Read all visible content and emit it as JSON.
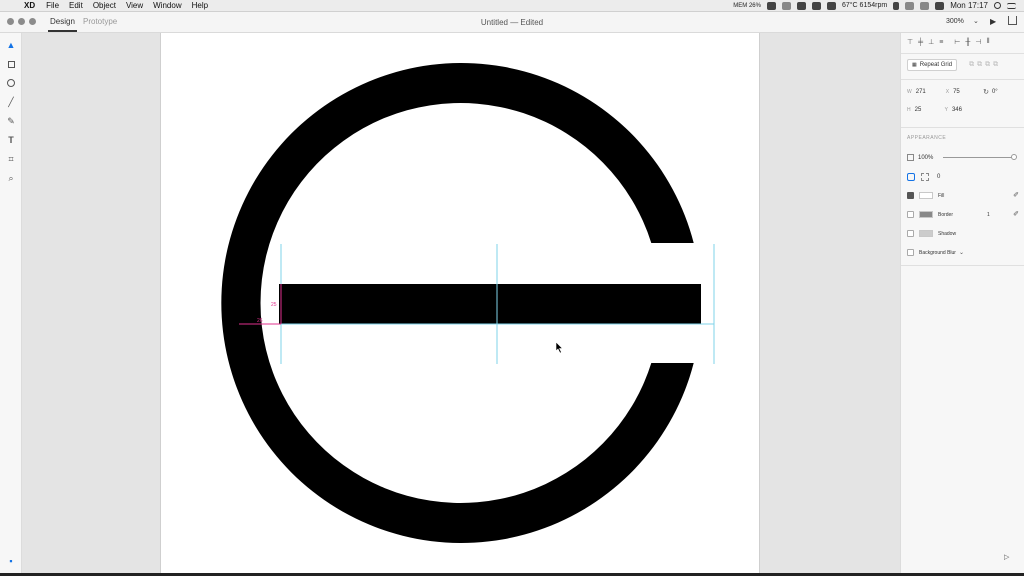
{
  "menubar": {
    "apple_icon": "apple-icon",
    "app": "XD",
    "items": [
      "File",
      "Edit",
      "Object",
      "View",
      "Window",
      "Help"
    ],
    "status": {
      "mem": "MEM 26%",
      "temp": "67°C 6154rpm",
      "clock": "Mon 17:17"
    }
  },
  "titlebar": {
    "tabs": [
      "Design",
      "Prototype"
    ],
    "active_tab": "Design",
    "doc_title": "Untitled — Edited",
    "zoom": "300%"
  },
  "toolbar": {
    "tools": [
      "select-tool-icon",
      "rectangle-tool-icon",
      "ellipse-tool-icon",
      "line-tool-icon",
      "pen-tool-icon",
      "text-tool-icon",
      "artboard-tool-icon",
      "zoom-tool-icon"
    ]
  },
  "canvas": {
    "measure_labels": [
      "25",
      "26"
    ]
  },
  "inspector": {
    "repeat_grid": "Repeat Grid",
    "w_label": "W",
    "w": "271",
    "x_label": "X",
    "x": "75",
    "rotation": "0°",
    "h_label": "H",
    "h": "25",
    "y_label": "Y",
    "y": "346",
    "appearance": "APPEARANCE",
    "opacity": "100%",
    "corner_radius": "0",
    "fill": "Fill",
    "border": "Border",
    "border_width": "1",
    "shadow": "Shadow",
    "background_blur": "Background Blur"
  },
  "colors": {
    "guide": "#7fd3ea",
    "measure": "#e0318e",
    "shape": "#000000"
  }
}
